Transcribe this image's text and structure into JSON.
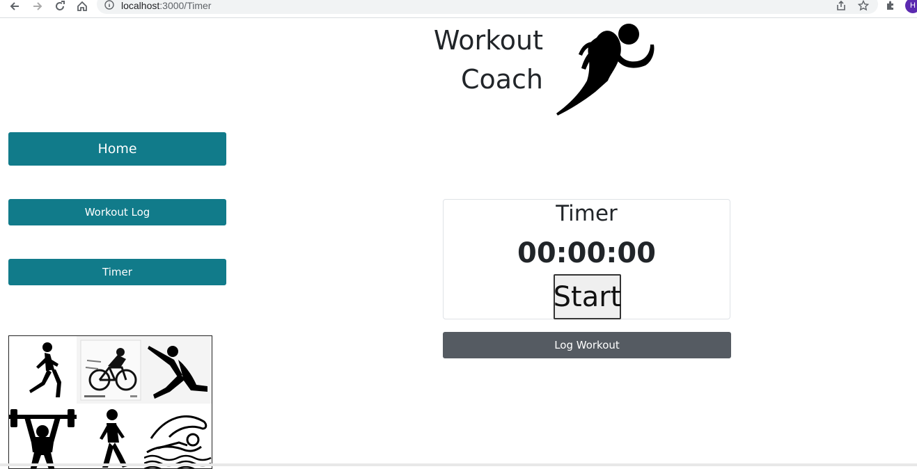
{
  "browser": {
    "url_host": "localhost",
    "url_rest": ":3000/Timer",
    "profile_initial": "H"
  },
  "header": {
    "title_line1": "Workout",
    "title_line2": "Coach",
    "logo_icon": "runner-icon"
  },
  "sidebar": {
    "items": [
      {
        "label": "Home"
      },
      {
        "label": "Workout Log"
      },
      {
        "label": "Timer"
      }
    ],
    "images": [
      "runner-woman-icon",
      "cyclist-photo",
      "yoga-pose-icon",
      "weightlifter-icon",
      "walker-icon",
      "swimmer-icon"
    ]
  },
  "timer": {
    "title": "Timer",
    "display": "00:00:00",
    "start_label": "Start",
    "log_label": "Log Workout"
  },
  "colors": {
    "nav_button": "#117b8a",
    "log_button": "#555b62"
  }
}
